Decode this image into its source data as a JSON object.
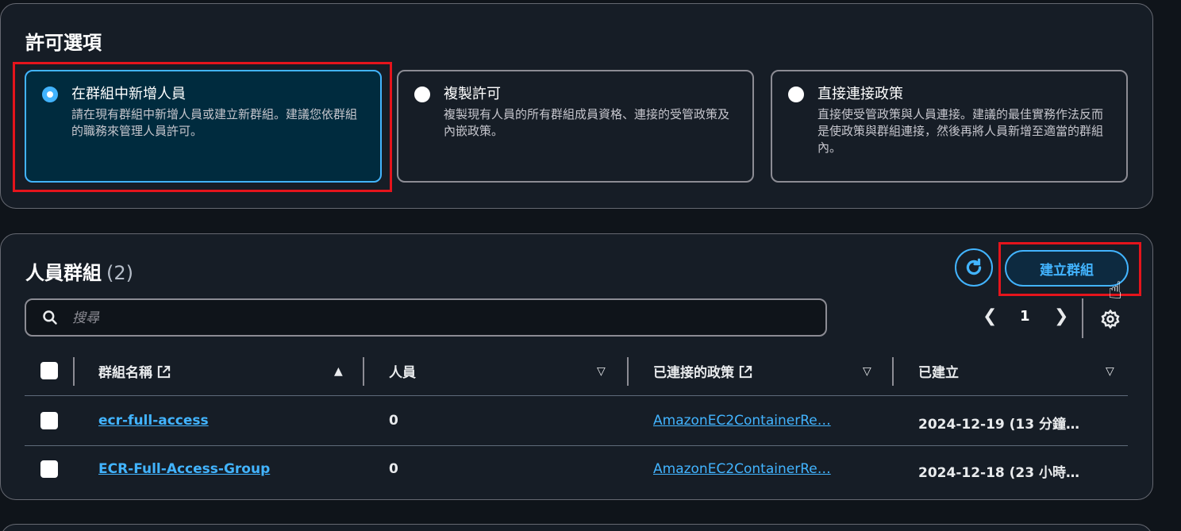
{
  "permissions": {
    "title": "許可選項",
    "options": [
      {
        "label": "在群組中新增人員",
        "description": "請在現有群組中新增人員或建立新群組。建議您依群組的職務來管理人員許可。",
        "selected": true
      },
      {
        "label": "複製許可",
        "description": "複製現有人員的所有群組成員資格、連接的受管政策及內嵌政策。",
        "selected": false
      },
      {
        "label": "直接連接政策",
        "description": "直接使受管政策與人員連接。建議的最佳實務作法反而是使政策與群組連接，然後再將人員新增至適當的群組內。",
        "selected": false
      }
    ]
  },
  "groups": {
    "title": "人員群組",
    "count": "(2)",
    "create_button": "建立群組",
    "search_placeholder": "搜尋",
    "page": "1",
    "columns": {
      "name": "群組名稱",
      "users": "人員",
      "policies": "已連接的政策",
      "created": "已建立"
    },
    "rows": [
      {
        "name": "ecr-full-access",
        "users": "0",
        "policies": "AmazonEC2ContainerRe…",
        "created": "2024-12-19 (13 分鐘…"
      },
      {
        "name": "ECR-Full-Access-Group",
        "users": "0",
        "policies": "AmazonEC2ContainerRe…",
        "created": "2024-12-18 (23 小時…"
      }
    ]
  },
  "colors": {
    "accent": "#42b4ff",
    "highlight": "#e5141c",
    "background": "#0f141a",
    "panel": "#161d26"
  },
  "icons": {
    "refresh": "refresh-icon",
    "search": "search-icon",
    "settings": "gear-icon",
    "external": "external-link-icon",
    "cursor": "hand-pointer-icon"
  }
}
